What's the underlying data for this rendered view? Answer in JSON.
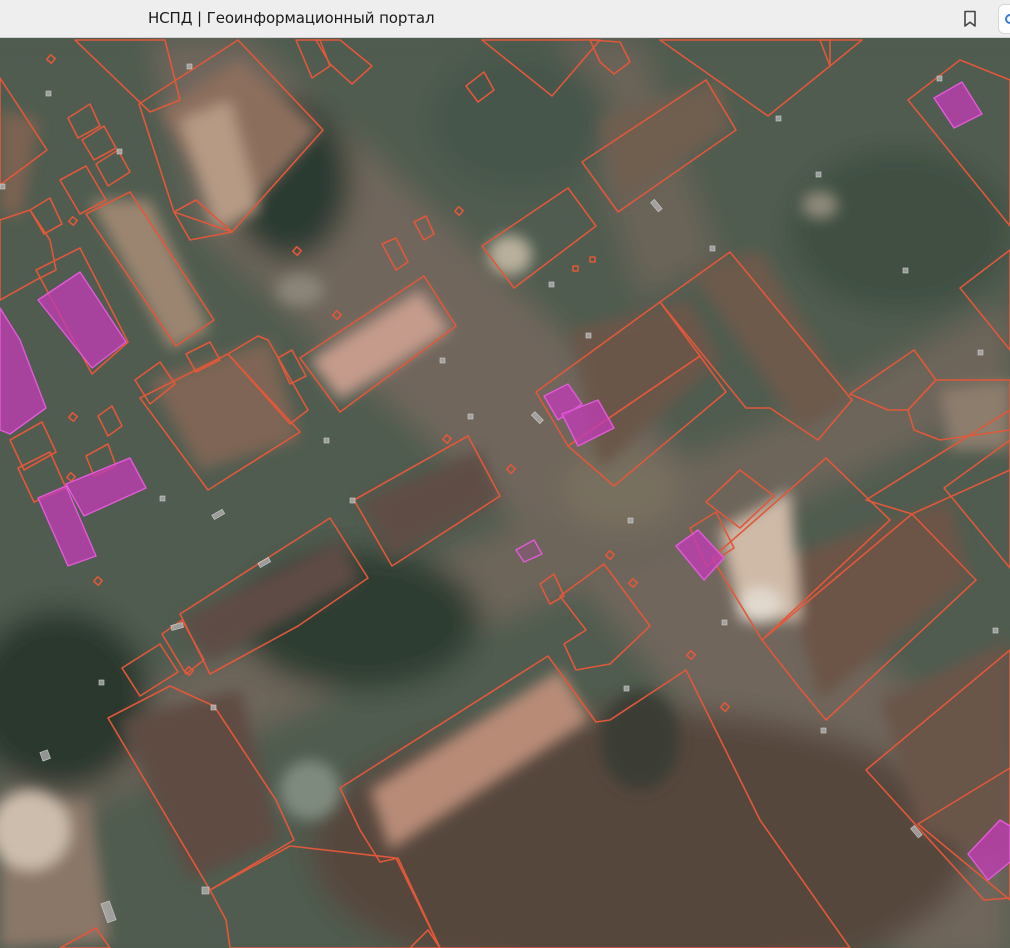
{
  "tab": {
    "title": "НСПД | Геоинформационный портал"
  },
  "icons": {
    "bookmark": "bookmark-icon",
    "sidebar": "sidebar-toggle-icon"
  },
  "map": {
    "layer": "satellite-imagery",
    "colors": {
      "parcel_outline": "#e0583a",
      "selected_fill": "#c03cb4",
      "selected_outline": "#e25ad8",
      "marker": "#b4b4b4"
    }
  }
}
